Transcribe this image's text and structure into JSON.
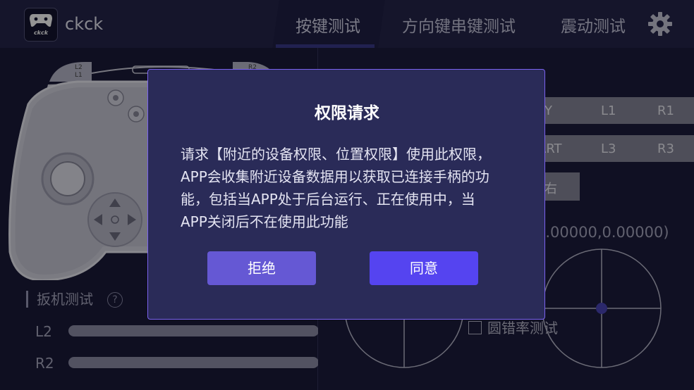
{
  "app": {
    "name": "ckck",
    "logo_text": "ckck"
  },
  "tabs": [
    {
      "label": "按键测试",
      "active": true
    },
    {
      "label": "方向键串键测试",
      "active": false
    },
    {
      "label": "震动测试",
      "active": false
    }
  ],
  "gamepad": {
    "labels": {
      "l2": "L2",
      "l1": "L1",
      "r2": "R2"
    }
  },
  "trigger_test": {
    "title": "扳机测试",
    "help": "?",
    "l2_label": "L2",
    "r2_label": "R2"
  },
  "right_panel": {
    "row1": [
      "Y",
      "L1",
      "R1"
    ],
    "row2": [
      "ART",
      "L3",
      "R3"
    ],
    "small_button": "右",
    "coords": "0.00000,0.00000)",
    "circle_test_label": "圆错率测试"
  },
  "dialog": {
    "title": "权限请求",
    "body": "请求【附近的设备权限、位置权限】使用此权限，APP会收集附近设备数据用以获取已连接手柄的功能，包括当APP处于后台运行、正在使用中，当APP关闭后不在使用此功能",
    "reject": "拒绝",
    "agree": "同意"
  },
  "colors": {
    "accent": "#5544f0",
    "dialog_bg": "#2a2b58",
    "dialog_border": "#7a62ee",
    "background": "#1d1d3d"
  }
}
